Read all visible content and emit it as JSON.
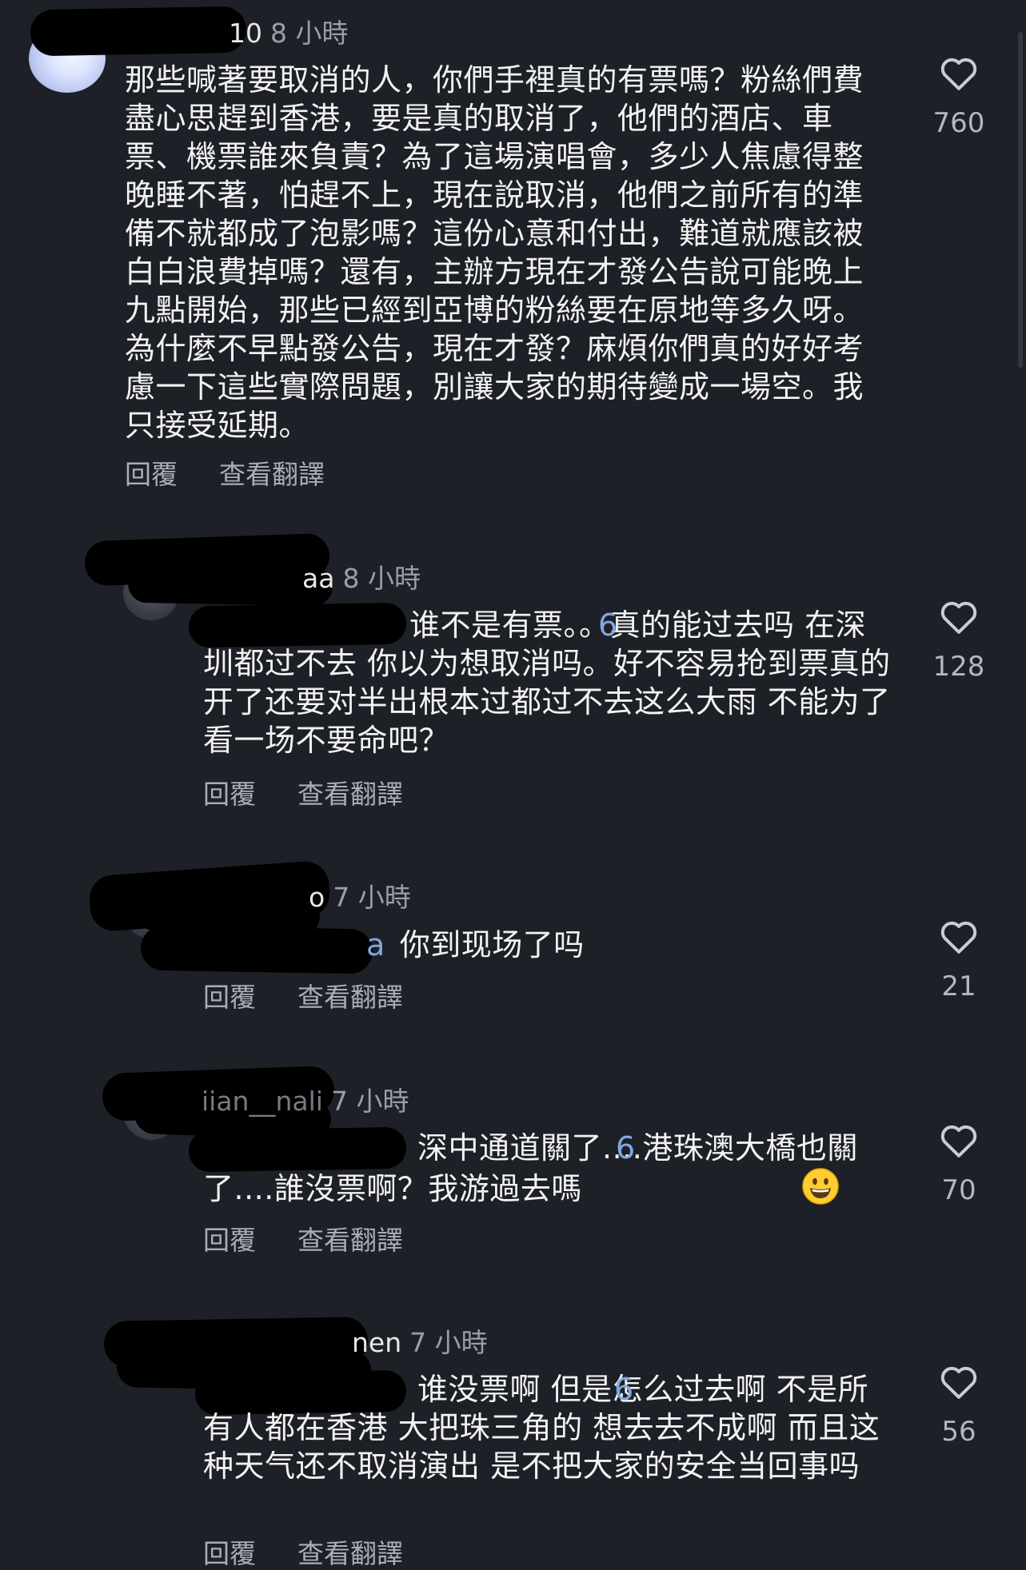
{
  "comments": [
    {
      "username_suffix": "10",
      "time": "8 小時",
      "text": "那些喊著要取消的人，你們手裡真的有票嗎？粉絲們費盡心思趕到香港，要是真的取消了，他們的酒店、車票、機票誰來負責？為了這場演唱會，多少人焦慮得整晚睡不著，怕趕不上，現在說取消，他們之前所有的準備不就都成了泡影嗎？這份心意和付出，難道就應該被白白浪費掉嗎？還有，主辦方現在才發公告說可能晚上九點開始，那些已經到亞博的粉絲要在原地等多久呀。為什麼不早點發公告，現在才發？麻煩你們真的好好考慮一下這些實際問題，別讓大家的期待變成一場空。我只接受延期。",
      "reply_label": "回覆",
      "translate_label": "查看翻譯",
      "likes": "760"
    },
    {
      "username_suffix": "aa",
      "time": "8 小時",
      "mention_suffix": "6",
      "text": "谁不是有票。。真的能过去吗 在深圳都过不去 你以为想取消吗。好不容易抢到票真的开了还要对半出根本过都过不去这么大雨 不能为了看一场不要命吧？",
      "reply_label": "回覆",
      "translate_label": "查看翻譯",
      "likes": "128"
    },
    {
      "username_suffix": "o",
      "time": "7 小時",
      "mention_suffix": "a",
      "text": "你到现场了吗",
      "reply_label": "回覆",
      "translate_label": "查看翻譯",
      "likes": "21"
    },
    {
      "username_suffix": "iian__nali",
      "time": "7 小時",
      "mention_suffix": "6",
      "text": "深中通道關了....港珠澳大橋也關了....誰沒票啊？我游過去嗎",
      "emoji": "grinning-face-emoji",
      "reply_label": "回覆",
      "translate_label": "查看翻譯",
      "likes": "70"
    },
    {
      "username_suffix": "nen",
      "time": "7 小時",
      "mention_suffix": "6",
      "text": "谁没票啊 但是怎么过去啊 不是所有人都在香港 大把珠三角的 想去去不成啊 而且这种天气还不取消演出 是不把大家的安全当回事吗",
      "reply_label": "回覆",
      "translate_label": "查看翻譯",
      "likes": "56"
    }
  ],
  "icons": {
    "like": "heart-outline-icon"
  },
  "colors": {
    "background": "#1d2026",
    "text": "#f2f2f2",
    "muted": "#9a9ea6",
    "mention": "#7fa8e0"
  }
}
